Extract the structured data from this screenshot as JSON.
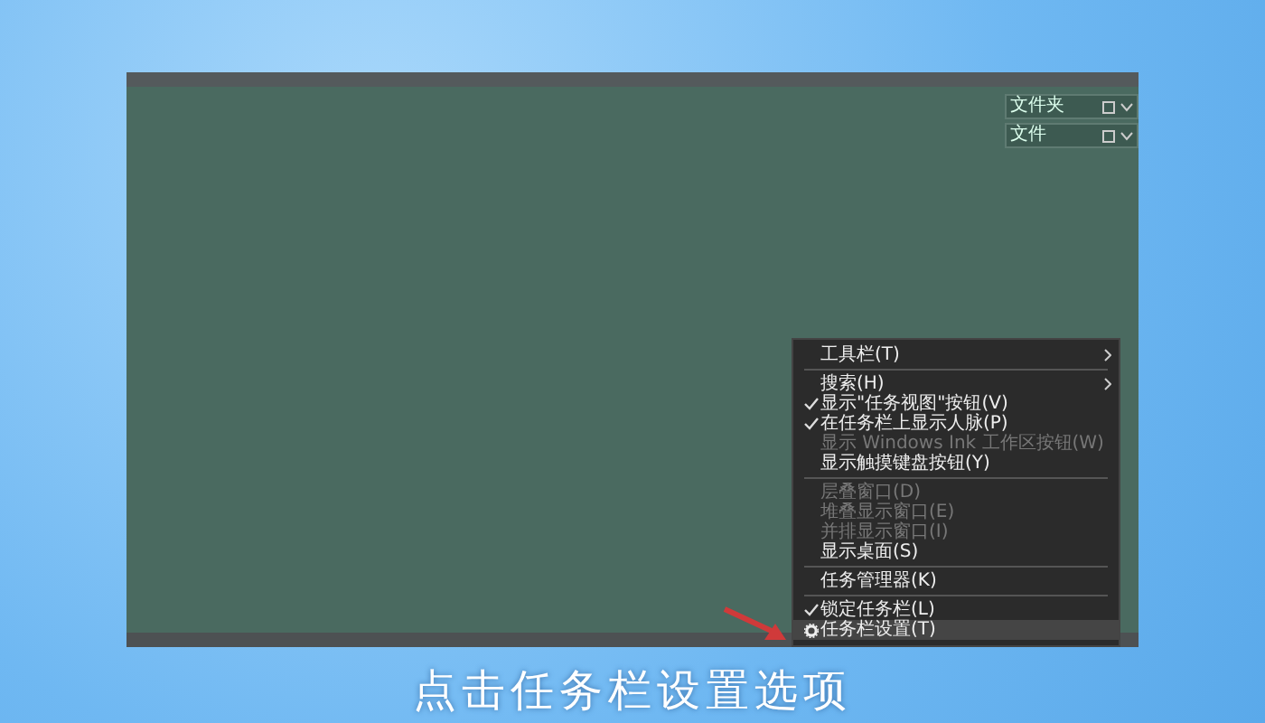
{
  "desktop_widgets": [
    {
      "label": "文件夹"
    },
    {
      "label": "文件"
    }
  ],
  "context_menu": {
    "items": [
      {
        "kind": "item",
        "label": "工具栏(T)",
        "submenu": true,
        "checked": false,
        "disabled": false,
        "highlighted": false
      },
      {
        "kind": "separator"
      },
      {
        "kind": "item",
        "label": "搜索(H)",
        "submenu": true,
        "checked": false,
        "disabled": false,
        "highlighted": false
      },
      {
        "kind": "item",
        "label": "显示\"任务视图\"按钮(V)",
        "submenu": false,
        "checked": true,
        "disabled": false,
        "highlighted": false
      },
      {
        "kind": "item",
        "label": "在任务栏上显示人脉(P)",
        "submenu": false,
        "checked": true,
        "disabled": false,
        "highlighted": false
      },
      {
        "kind": "item",
        "label": "显示 Windows Ink 工作区按钮(W)",
        "submenu": false,
        "checked": false,
        "disabled": true,
        "highlighted": false
      },
      {
        "kind": "item",
        "label": "显示触摸键盘按钮(Y)",
        "submenu": false,
        "checked": false,
        "disabled": false,
        "highlighted": false
      },
      {
        "kind": "separator"
      },
      {
        "kind": "item",
        "label": "层叠窗口(D)",
        "submenu": false,
        "checked": false,
        "disabled": true,
        "highlighted": false
      },
      {
        "kind": "item",
        "label": "堆叠显示窗口(E)",
        "submenu": false,
        "checked": false,
        "disabled": true,
        "highlighted": false
      },
      {
        "kind": "item",
        "label": "并排显示窗口(I)",
        "submenu": false,
        "checked": false,
        "disabled": true,
        "highlighted": false
      },
      {
        "kind": "item",
        "label": "显示桌面(S)",
        "submenu": false,
        "checked": false,
        "disabled": false,
        "highlighted": false
      },
      {
        "kind": "separator"
      },
      {
        "kind": "item",
        "label": "任务管理器(K)",
        "submenu": false,
        "checked": false,
        "disabled": false,
        "highlighted": false
      },
      {
        "kind": "separator"
      },
      {
        "kind": "item",
        "label": "锁定任务栏(L)",
        "submenu": false,
        "checked": true,
        "disabled": false,
        "highlighted": false
      },
      {
        "kind": "gear-item",
        "label": "任务栏设置(T)",
        "submenu": false,
        "disabled": false,
        "highlighted": true
      }
    ]
  },
  "subtitle": "点击任务栏设置选项"
}
